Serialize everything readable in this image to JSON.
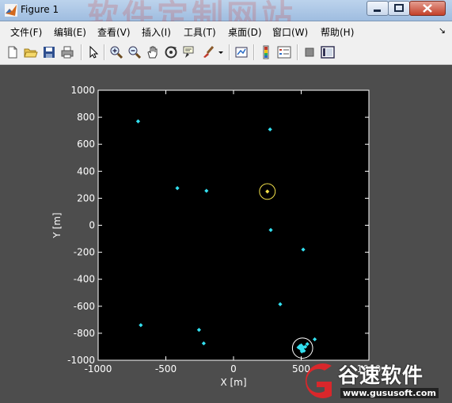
{
  "window": {
    "title": "Figure 1",
    "watermark_text": "软件定制网站"
  },
  "menu": [
    {
      "label": "文件(F)"
    },
    {
      "label": "编辑(E)"
    },
    {
      "label": "查看(V)"
    },
    {
      "label": "插入(I)"
    },
    {
      "label": "工具(T)"
    },
    {
      "label": "桌面(D)"
    },
    {
      "label": "窗口(W)"
    },
    {
      "label": "帮助(H)"
    }
  ],
  "toolbar": {
    "icons": [
      "new-figure-icon",
      "open-file-icon",
      "save-icon",
      "print-icon",
      "pointer-icon",
      "zoom-in-icon",
      "zoom-out-icon",
      "pan-hand-icon",
      "rotate-3d-icon",
      "data-cursor-icon",
      "brush-icon",
      "dropdown-arrow-icon",
      "link-plot-icon",
      "colorbar-icon",
      "legend-icon",
      "hide-plot-tools-icon",
      "show-plot-tools-icon"
    ]
  },
  "logo": {
    "name": "谷速软件",
    "url": "www.gususoft.com",
    "accent_color": "#d9272b"
  },
  "chart_data": {
    "type": "scatter",
    "title": "",
    "xlabel": "X [m]",
    "ylabel": "Y [m]",
    "xlim": [
      -1000,
      1000
    ],
    "ylim": [
      -1000,
      1000
    ],
    "x_ticks": [
      -1000,
      -500,
      0,
      500,
      1000
    ],
    "x_tick_labels": [
      "-1000",
      "-500",
      "0",
      "500",
      "1000"
    ],
    "y_ticks": [
      1000,
      800,
      600,
      400,
      200,
      0,
      -200,
      -400,
      -600,
      -800,
      -1000
    ],
    "y_tick_labels": [
      "1000",
      "800",
      "600",
      "400",
      "200",
      "0",
      "-200",
      "-400",
      "-600",
      "-800",
      "-1000"
    ],
    "background": "#000000",
    "figure_background": "#4d4d4d",
    "grid": false,
    "series": [
      {
        "color": "#33e0f0",
        "points": [
          [
            -705,
            770
          ],
          [
            270,
            710
          ],
          [
            -415,
            275
          ],
          [
            -200,
            255
          ],
          [
            275,
            -35
          ],
          [
            515,
            -180
          ],
          [
            345,
            -585
          ],
          [
            -685,
            -740
          ],
          [
            -255,
            -775
          ],
          [
            -220,
            -875
          ],
          [
            600,
            -845
          ],
          [
            480,
            -905
          ],
          [
            500,
            -890
          ],
          [
            510,
            -920
          ],
          [
            530,
            -900
          ],
          [
            505,
            -935
          ],
          [
            495,
            -915
          ],
          [
            520,
            -930
          ],
          [
            545,
            -880
          ],
          [
            490,
            -895
          ],
          [
            515,
            -905
          ]
        ]
      },
      {
        "color": "#f2e04a",
        "points": [
          [
            250,
            250
          ]
        ]
      }
    ],
    "circles": [
      {
        "x": 250,
        "y": 250,
        "radius": 58,
        "color": "#f2e04a"
      },
      {
        "x": 510,
        "y": -910,
        "radius": 75,
        "color": "#ffffff"
      }
    ]
  }
}
